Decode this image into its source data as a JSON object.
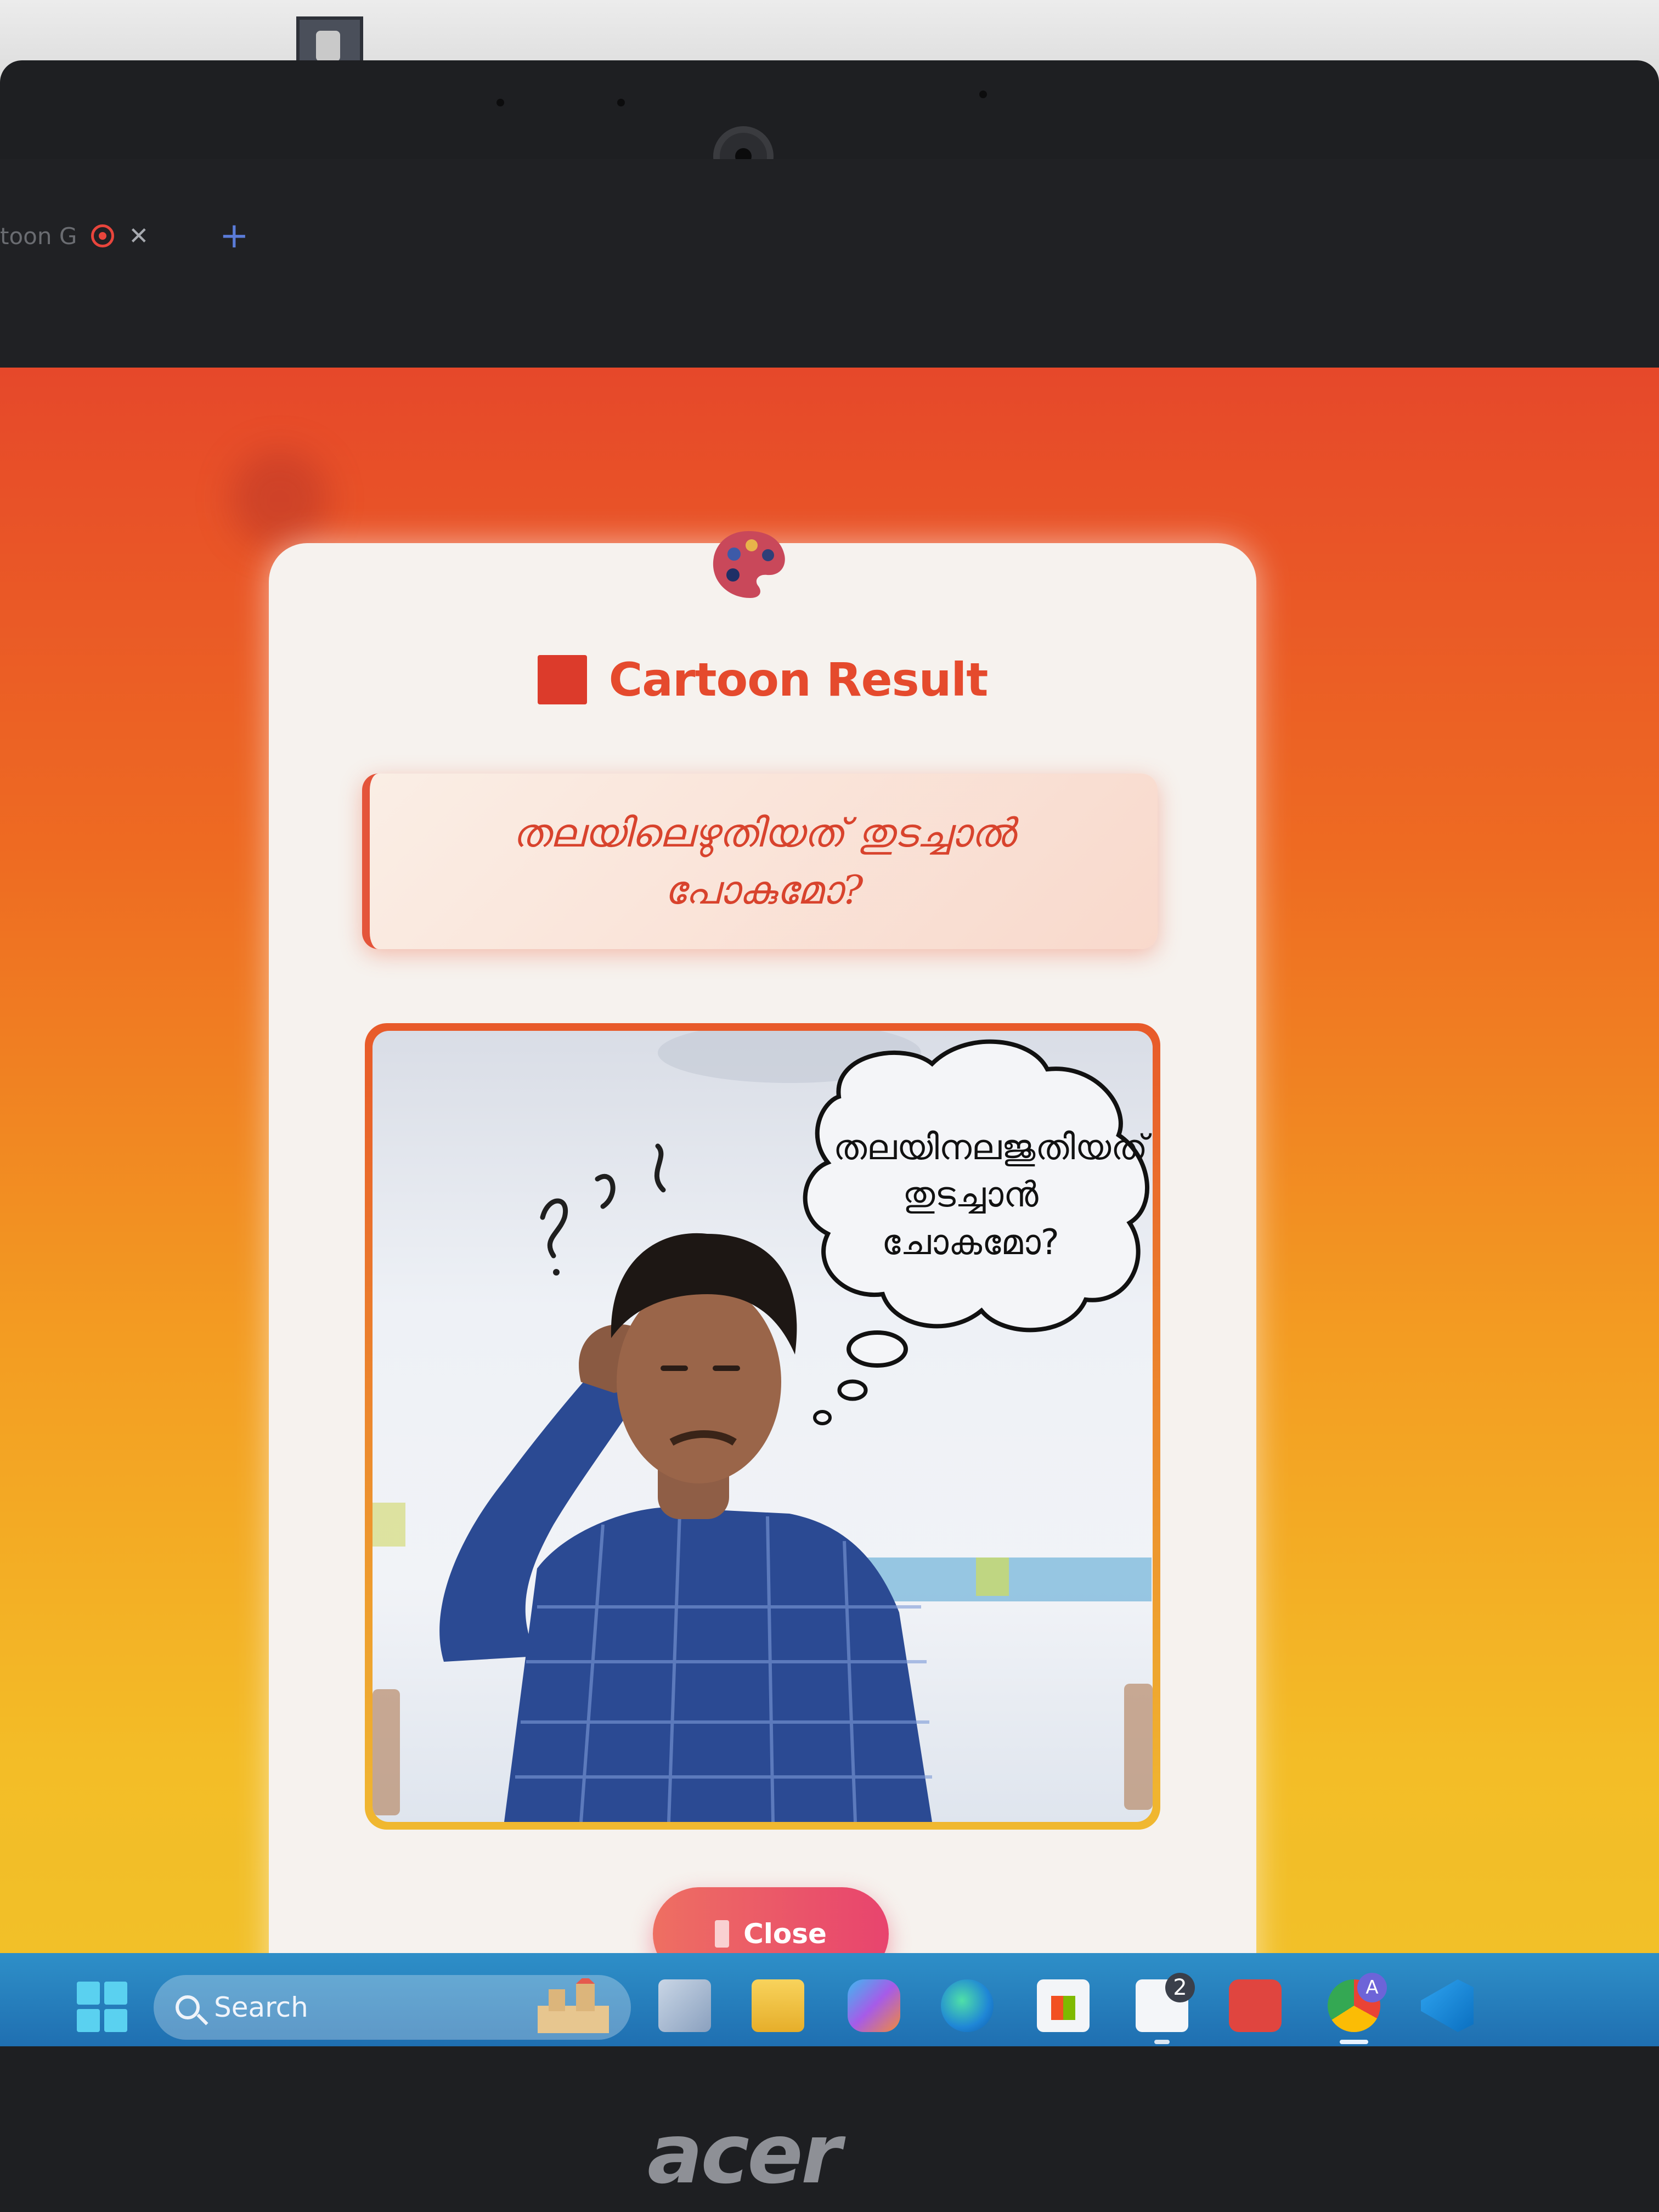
{
  "browser": {
    "tab_title": "toon G",
    "tab_close": "✕",
    "new_tab": "+"
  },
  "modal": {
    "title": "Cartoon Result",
    "question": "തലയിലെഴുതിയത് തുടച്ചാൽ പോകുമോ?",
    "image": {
      "thought_bubble_text": "തലയിനലജുതിയത് തുടച്ചാൻ ചോകമോ?",
      "scribble_marks": "?"
    },
    "close_label": "Close"
  },
  "taskbar": {
    "search_label": "Search",
    "notes_badge": "2",
    "chrome_badge": "A"
  },
  "device": {
    "brand": "acer"
  },
  "colors": {
    "accent": "#e54a2d",
    "gradient_top": "#e6482a",
    "gradient_bottom": "#f1c22a",
    "close_button": "#e8446e"
  }
}
